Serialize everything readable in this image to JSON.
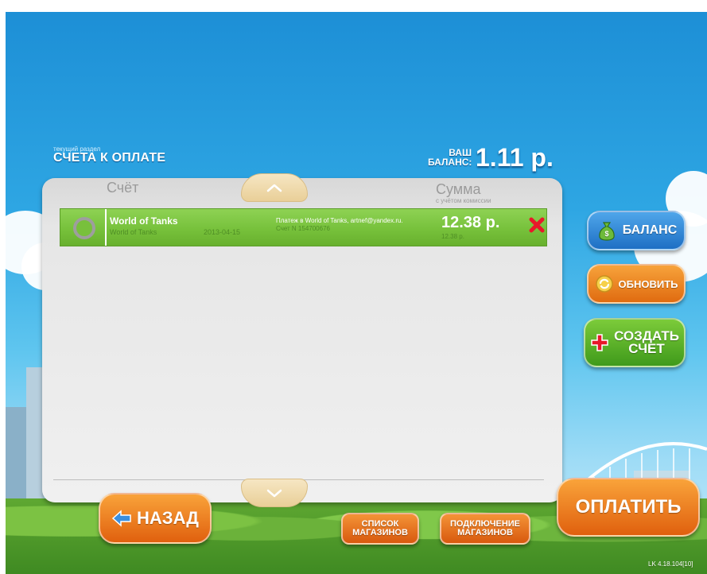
{
  "header": {
    "section_hint": "текущий раздел",
    "section_title": "СЧЕТА К ОПЛАТЕ",
    "balance_label_line1": "ВАШ",
    "balance_label_line2": "БАЛАНС:",
    "balance_value": "1.11 р."
  },
  "table": {
    "col_account": "Счёт",
    "col_sum": "Сумма",
    "col_sum_sub": "с учётом комиссии",
    "rows": [
      {
        "name": "World of Tanks",
        "sub_name": "World of Tanks",
        "date": "2013-04-15",
        "description_line1": "Платеж в World of Tanks, artnef@yandex.ru.",
        "description_line2": "Счет N 154700676",
        "amount": "12.38 р.",
        "amount_sub": "12.38 р."
      }
    ]
  },
  "buttons": {
    "balance": "БАЛАНС",
    "refresh": "ОБНОВИТЬ",
    "create_line1": "СОЗДАТЬ",
    "create_line2": "СЧЕТ",
    "pay": "ОПЛАТИТЬ",
    "back": "НАЗАД",
    "shops_line1": "СПИСОК",
    "shops_line2": "МАГАЗИНОВ",
    "connect_line1": "ПОДКЛЮЧЕНИЕ",
    "connect_line2": "МАГАЗИНОВ"
  },
  "footer": {
    "version": "LK 4.18.104[10]"
  },
  "colors": {
    "row_selected": "#77c13b",
    "accent_orange": "#e8741a",
    "accent_blue": "#2d85d6",
    "accent_green": "#56ab26"
  }
}
